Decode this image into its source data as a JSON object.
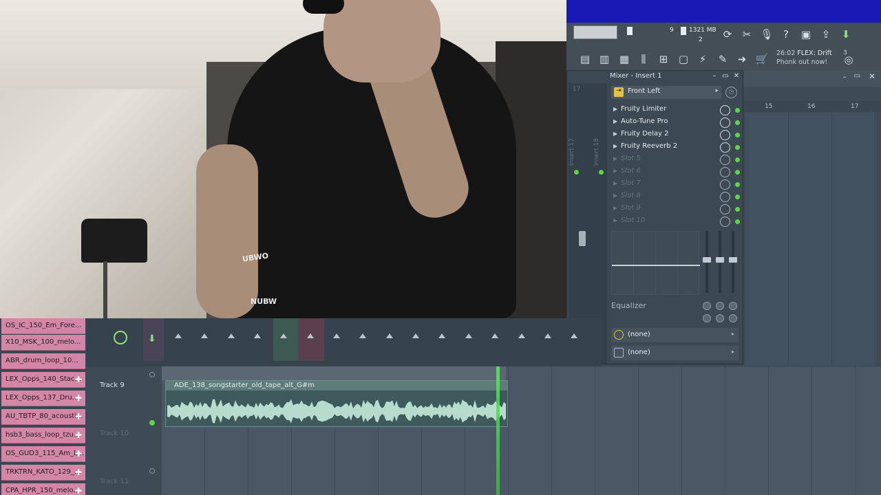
{
  "toolbar": {
    "memory": "1321 MB",
    "polyphony_value": "9",
    "polyphony_sub": "2",
    "news_time": "26:02",
    "news_title": "FLEX: Drift",
    "news_body": "Phonk out now!",
    "news_badge": "3"
  },
  "mixer": {
    "title": "Mixer - Insert 1",
    "route": "Front Left",
    "strip_label_1": "Insert 17",
    "strip_label_2": "Insert 18",
    "strip_num": "17",
    "slots": [
      {
        "name": "Fruity Limiter"
      },
      {
        "name": "Auto-Tune Pro"
      },
      {
        "name": "Fruity Delay 2"
      },
      {
        "name": "Fruity Reeverb 2"
      },
      {
        "name": "Slot 5"
      },
      {
        "name": "Slot 6"
      },
      {
        "name": "Slot 7"
      },
      {
        "name": "Slot 8"
      },
      {
        "name": "Slot 9"
      },
      {
        "name": "Slot 10"
      }
    ],
    "eq_label": "Equalizer",
    "input": "(none)",
    "output": "(none)"
  },
  "playlist_ruler": [
    "15",
    "16",
    "17"
  ],
  "browser": {
    "items": [
      "OS_IC_150_Em_Fore...",
      "X10_MSK_100_melo...",
      "ABR_drum_loop_10...",
      "LEX_Opps_140_Stac...",
      "LEX_Opps_137_Dru...",
      "AU_TBTP_80_acousti...",
      "hsb3_bass_loop_tzu...",
      "OS_GUD3_115_Am_L...",
      "TRKTRN_KATO_129_...",
      "CPA_HPR_150_melo..."
    ]
  },
  "tracks": {
    "track9": "Track 9",
    "track10": "Track 10",
    "track11": "Track 11"
  },
  "clip": {
    "title": "ADE_138_songstarter_old_tape_alt_G#m"
  },
  "webcam": {
    "chair_text_1": "UBWO",
    "chair_text_2": "NUBW"
  },
  "colors": {
    "title_bar": "#1919b4",
    "accent_green": "#5fd44a",
    "clip_pink": "#d486a6",
    "playhead": "#3fff3f"
  }
}
